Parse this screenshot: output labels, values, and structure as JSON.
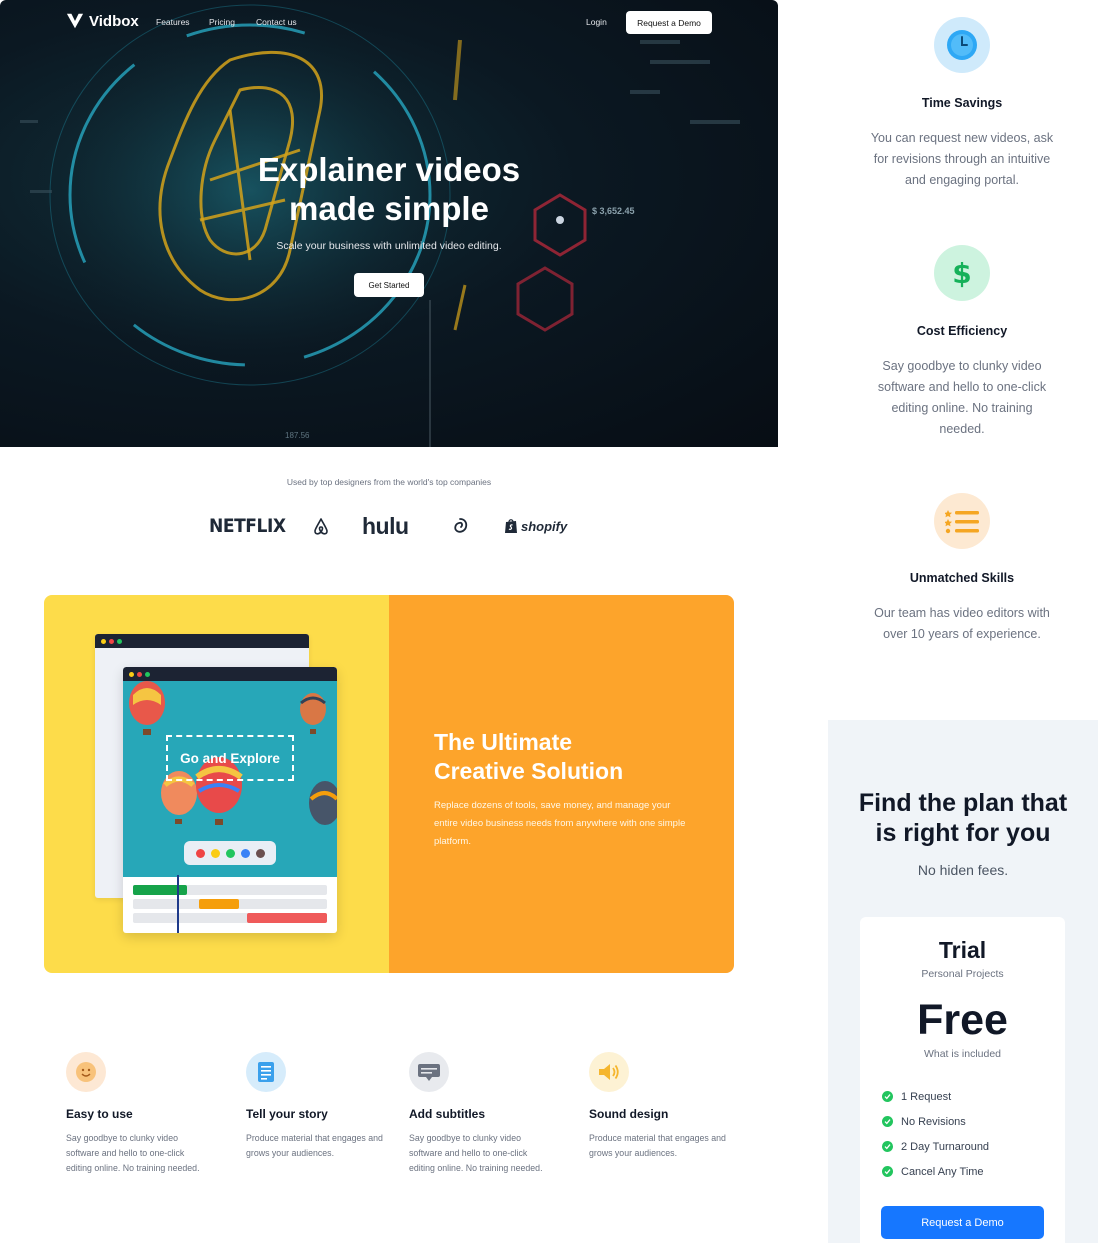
{
  "nav": {
    "brand": "Vidbox",
    "links": [
      "Features",
      "Pricing",
      "Contact us"
    ],
    "login": "Login",
    "demo": "Request a Demo"
  },
  "hero": {
    "title_line1": "Explainer videos",
    "title_line2": "made simple",
    "subtitle": "Scale your business with unlimited video editing.",
    "cta": "Get Started",
    "overlay_values": [
      "$ 3,652.45",
      "187.56"
    ]
  },
  "logos": {
    "caption": "Used by top designers from the world's top companies",
    "brands": [
      "NETFLIX",
      "airbnb",
      "hulu",
      "dribbble",
      "shopify"
    ]
  },
  "creative": {
    "explore_label": "Go and Explore",
    "title_line1": "The Ultimate",
    "title_line2": "Creative Solution",
    "text": "Replace dozens of tools, save money, and manage your entire video business needs from anywhere with one simple platform.",
    "palette_colors": [
      "#ef4444",
      "#facc15",
      "#22c55e",
      "#3b82f6",
      "#6b4f4f"
    ]
  },
  "features": [
    {
      "title": "Easy to use",
      "text": "Say goodbye to clunky video software and hello to one-click editing online. No training needed.",
      "icon": "smiley-icon"
    },
    {
      "title": "Tell your story",
      "text": "Produce material that engages and grows your audiences.",
      "icon": "document-icon"
    },
    {
      "title": "Add subtitles",
      "text": "Say goodbye to clunky video software and hello to one-click editing online. No training needed.",
      "icon": "subtitles-icon"
    },
    {
      "title": "Sound design",
      "text": "Produce material that engages and grows your audiences.",
      "icon": "speaker-icon"
    }
  ],
  "benefits": [
    {
      "title": "Time Savings",
      "text": "You can request new videos, ask for revisions through an intuitive and engaging portal.",
      "icon": "clock-icon",
      "color": "#2ea8f5"
    },
    {
      "title": "Cost Efficiency",
      "text": "Say goodbye to clunky video software and hello to one-click editing online. No training needed.",
      "icon": "dollar-icon",
      "color": "#22c55e"
    },
    {
      "title": "Unmatched Skills",
      "text": "Our team has video editors with over 10 years of experience.",
      "icon": "list-icon",
      "color": "#f59e0b"
    }
  ],
  "pricing": {
    "title_line1": "Find the plan that",
    "title_line2": "is right for you",
    "subtitle": "No hiden fees.",
    "plan": {
      "name": "Trial",
      "desc": "Personal Projects",
      "price": "Free",
      "included_label": "What is included",
      "items": [
        "1 Request",
        "No Revisions",
        "2 Day Turnaround",
        "Cancel Any Time"
      ],
      "cta": "Request a Demo"
    }
  }
}
